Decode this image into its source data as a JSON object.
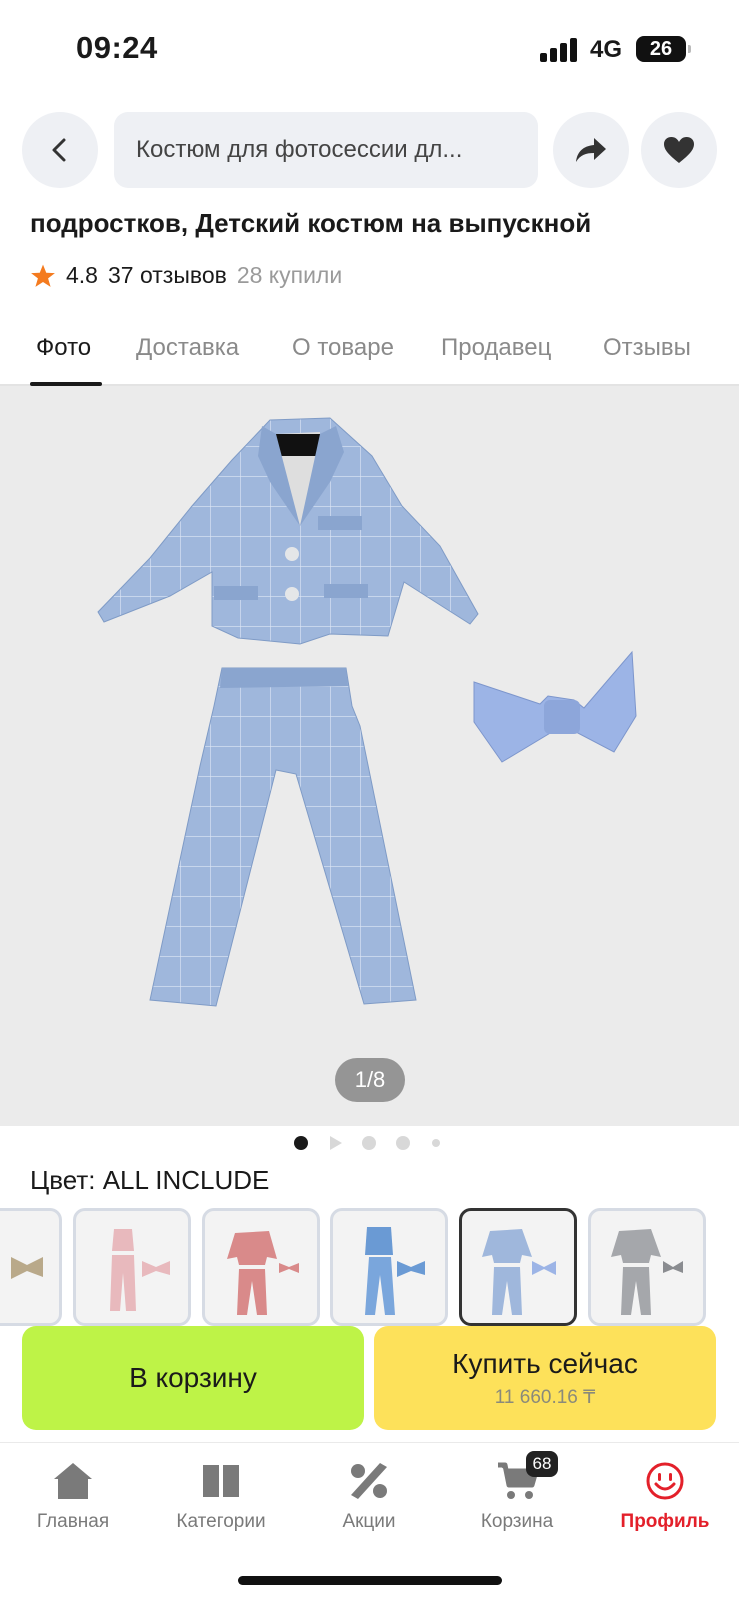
{
  "status_bar": {
    "time": "09:24",
    "network": "4G",
    "battery": "26"
  },
  "header": {
    "search_text": "Костюм для фотосессии дл..."
  },
  "product": {
    "title": "подростков, Детский костюм на выпускной",
    "rating": "4.8",
    "reviews": "37 отзывов",
    "purchased": "28 купили"
  },
  "tabs": [
    {
      "label": "Фото",
      "active": true
    },
    {
      "label": "Доставка"
    },
    {
      "label": "О товаре"
    },
    {
      "label": "Продавец"
    },
    {
      "label": "Отзывы"
    }
  ],
  "gallery": {
    "counter": "1/8"
  },
  "color": {
    "label": "Цвет: ALL INCLUDE"
  },
  "colors": {
    "suit_blue": "#9fb7dc",
    "suit_pink": "#e8b9bd",
    "suit_coral": "#d98a8a",
    "suit_gray": "#a5a7ab",
    "bow_tan": "#b9a98a",
    "accent_green": "#bef347",
    "accent_yellow": "#fde15a",
    "brand_red": "#e3202a"
  },
  "actions": {
    "cart_label": "В корзину",
    "buy_label": "Купить сейчас",
    "buy_price": "11 660.16 ₸"
  },
  "nav": [
    {
      "label": "Главная",
      "icon": "home-icon"
    },
    {
      "label": "Категории",
      "icon": "book-icon"
    },
    {
      "label": "Акции",
      "icon": "percent-icon"
    },
    {
      "label": "Корзина",
      "icon": "cart-icon",
      "badge": "68"
    },
    {
      "label": "Профиль",
      "icon": "profile-icon",
      "active": true
    }
  ]
}
